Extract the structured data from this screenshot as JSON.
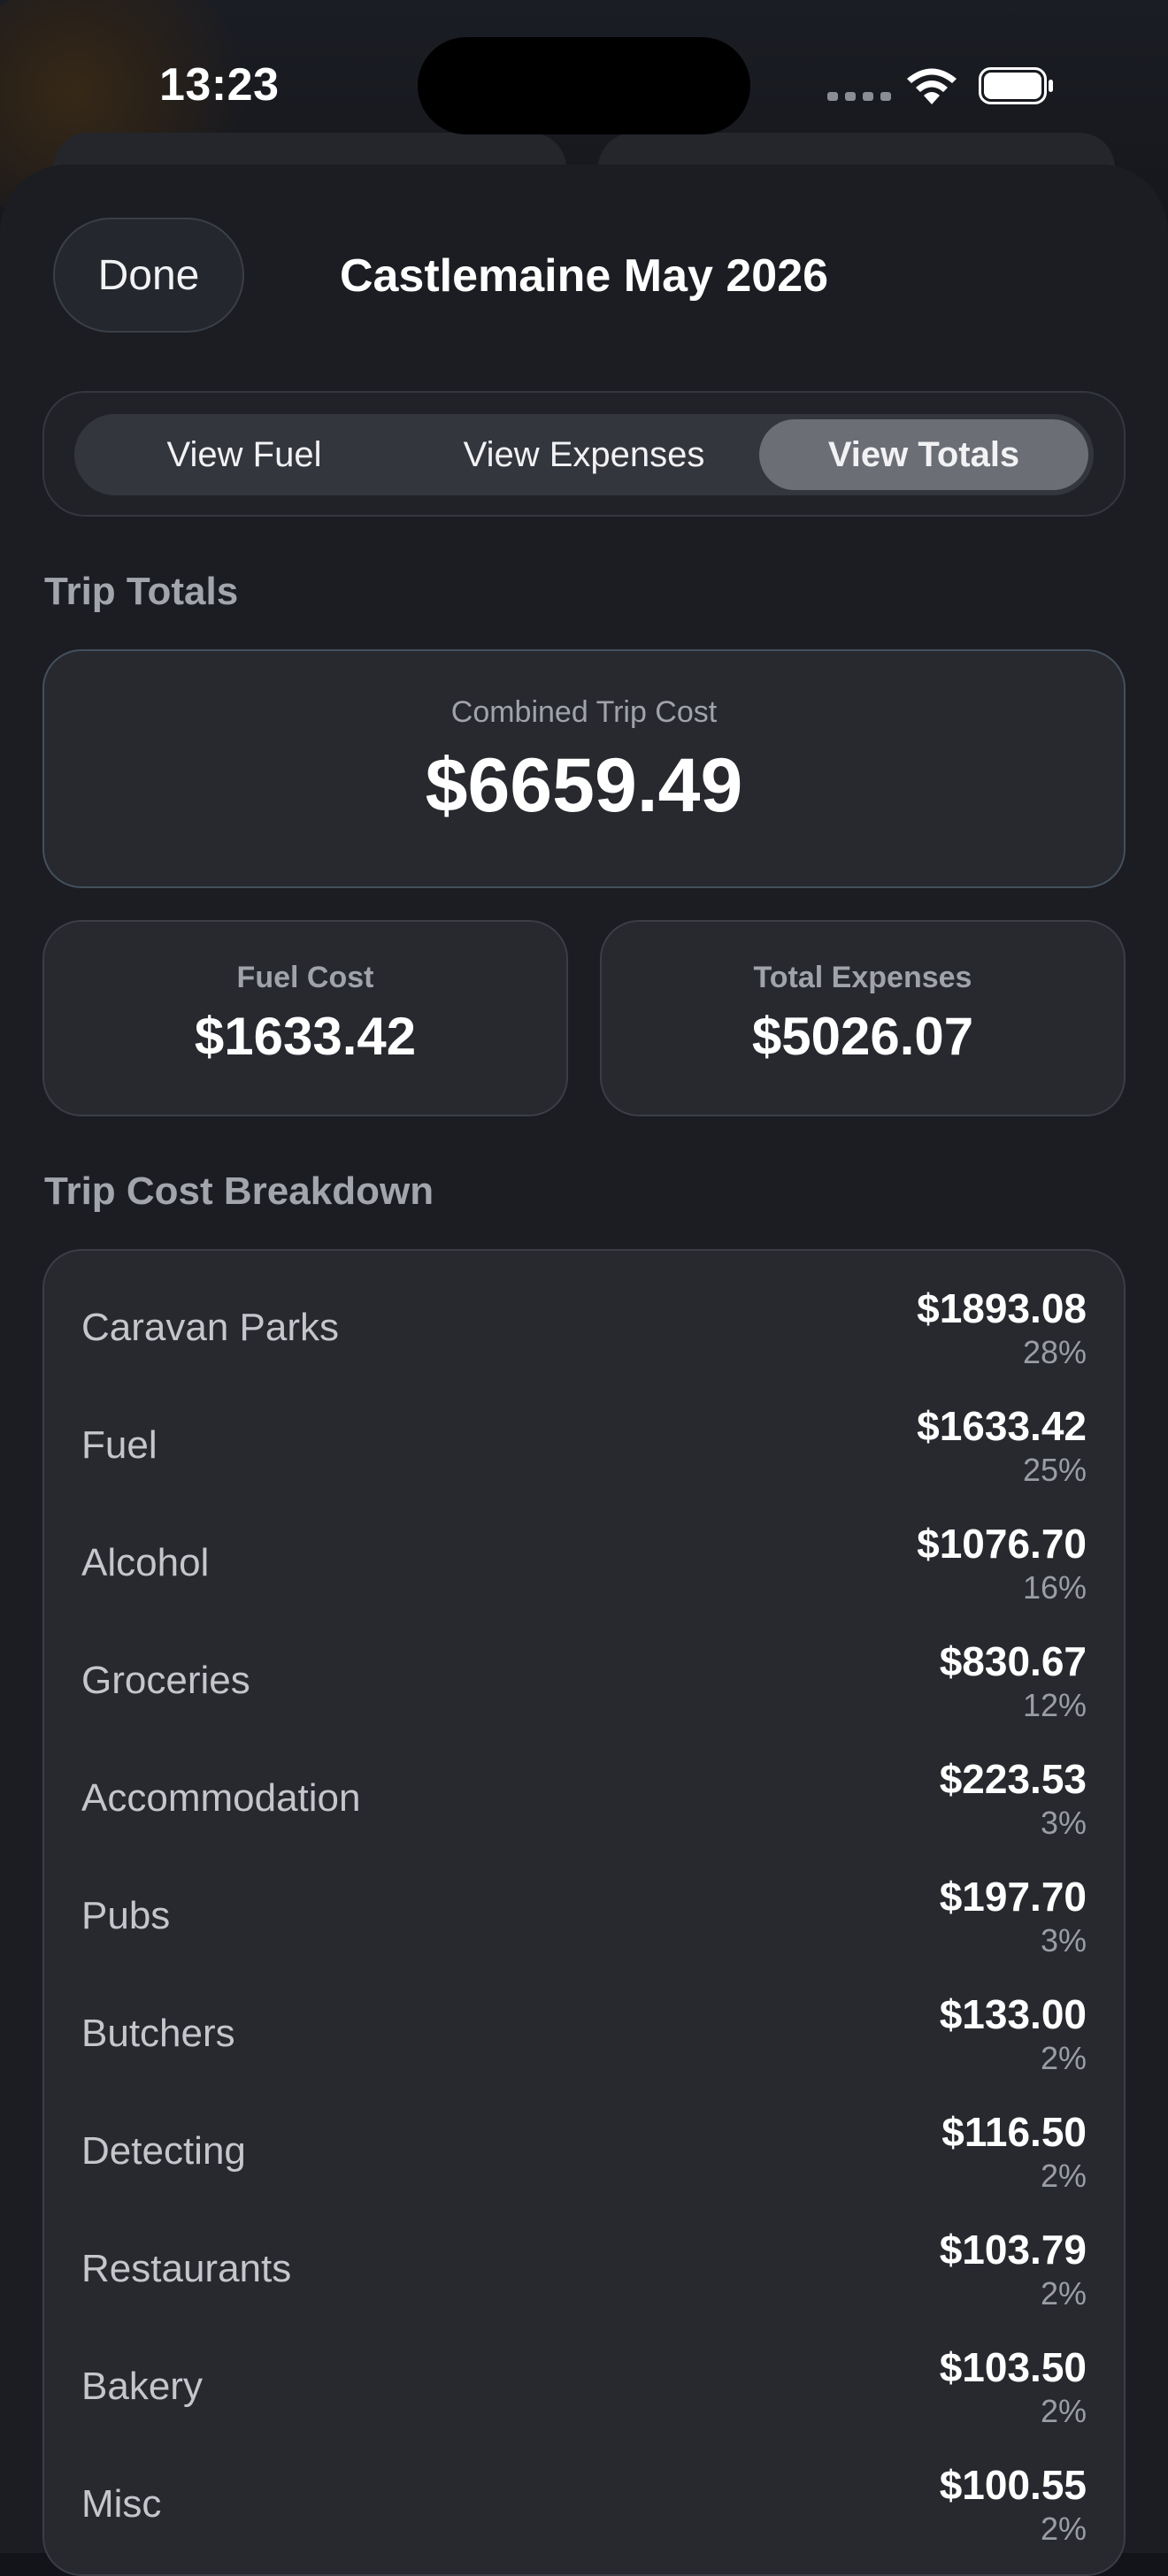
{
  "status_bar": {
    "time": "13:23"
  },
  "header": {
    "done_label": "Done",
    "title": "Castlemaine May 2026"
  },
  "segmented_control": {
    "options": [
      "View Fuel",
      "View Expenses",
      "View Totals"
    ],
    "selected": "View Totals"
  },
  "trip_totals": {
    "heading": "Trip Totals",
    "combined_label": "Combined Trip Cost",
    "combined_value": "$6659.49",
    "fuel_label": "Fuel Cost",
    "fuel_value": "$1633.42",
    "expenses_label": "Total Expenses",
    "expenses_value": "$5026.07"
  },
  "breakdown": {
    "heading": "Trip Cost Breakdown",
    "rows": [
      {
        "name": "Caravan Parks",
        "amount": "$1893.08",
        "percent": "28%"
      },
      {
        "name": "Fuel",
        "amount": "$1633.42",
        "percent": "25%"
      },
      {
        "name": "Alcohol",
        "amount": "$1076.70",
        "percent": "16%"
      },
      {
        "name": "Groceries",
        "amount": "$830.67",
        "percent": "12%"
      },
      {
        "name": "Accommodation",
        "amount": "$223.53",
        "percent": "3%"
      },
      {
        "name": "Pubs",
        "amount": "$197.70",
        "percent": "3%"
      },
      {
        "name": "Butchers",
        "amount": "$133.00",
        "percent": "2%"
      },
      {
        "name": "Detecting",
        "amount": "$116.50",
        "percent": "2%"
      },
      {
        "name": "Restaurants",
        "amount": "$103.79",
        "percent": "2%"
      },
      {
        "name": "Bakery",
        "amount": "$103.50",
        "percent": "2%"
      },
      {
        "name": "Misc",
        "amount": "$100.55",
        "percent": "2%"
      }
    ]
  },
  "colors": {
    "background": "#121419",
    "sheet": "#1b1d22",
    "card": "#27292f",
    "segment_active": "#6b6e75"
  }
}
